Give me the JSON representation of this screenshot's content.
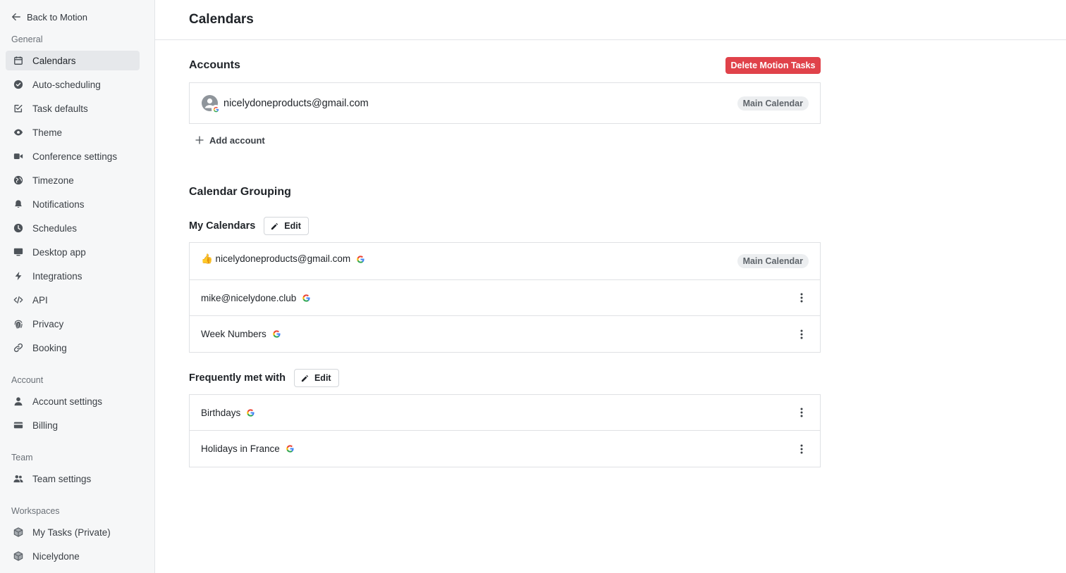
{
  "sidebar": {
    "back_label": "Back to Motion",
    "sections": {
      "general": "General",
      "account": "Account",
      "team": "Team",
      "workspaces": "Workspaces"
    },
    "general_items": [
      {
        "label": "Calendars",
        "icon": "calendar-icon",
        "active": true
      },
      {
        "label": "Auto-scheduling",
        "icon": "check-circle-icon"
      },
      {
        "label": "Task defaults",
        "icon": "checkbox-edit-icon"
      },
      {
        "label": "Theme",
        "icon": "eye-icon"
      },
      {
        "label": "Conference settings",
        "icon": "video-icon"
      },
      {
        "label": "Timezone",
        "icon": "globe-icon"
      },
      {
        "label": "Notifications",
        "icon": "bell-icon"
      },
      {
        "label": "Schedules",
        "icon": "clock-icon"
      },
      {
        "label": "Desktop app",
        "icon": "monitor-icon"
      },
      {
        "label": "Integrations",
        "icon": "bolt-icon"
      },
      {
        "label": "API",
        "icon": "code-icon"
      },
      {
        "label": "Privacy",
        "icon": "fingerprint-icon"
      },
      {
        "label": "Booking",
        "icon": "link-icon"
      }
    ],
    "account_items": [
      {
        "label": "Account settings",
        "icon": "user-icon"
      },
      {
        "label": "Billing",
        "icon": "credit-card-icon"
      }
    ],
    "team_items": [
      {
        "label": "Team settings",
        "icon": "users-icon"
      }
    ],
    "workspace_items": [
      {
        "label": "My Tasks (Private)",
        "icon": "cube-icon"
      },
      {
        "label": "Nicelydone",
        "icon": "cube-icon"
      }
    ]
  },
  "header": {
    "title": "Calendars"
  },
  "accounts": {
    "title": "Accounts",
    "delete_label": "Delete Motion Tasks",
    "email": "nicelydoneproducts@gmail.com",
    "badge": "Main Calendar",
    "add_label": "Add account"
  },
  "grouping": {
    "title": "Calendar Grouping",
    "edit_label": "Edit",
    "my_calendars": {
      "title": "My Calendars",
      "items": [
        {
          "name": "👍 nicelydoneproducts@gmail.com",
          "badge": "Main Calendar"
        },
        {
          "name": "mike@nicelydone.club"
        },
        {
          "name": "Week Numbers"
        }
      ]
    },
    "frequently_met": {
      "title": "Frequently met with",
      "items": [
        {
          "name": "Birthdays"
        },
        {
          "name": "Holidays in France"
        }
      ]
    }
  },
  "colors": {
    "accent_danger": "#e0424a",
    "sidebar_bg": "#f6f7f8",
    "active_item_bg": "#e6e8eb"
  }
}
